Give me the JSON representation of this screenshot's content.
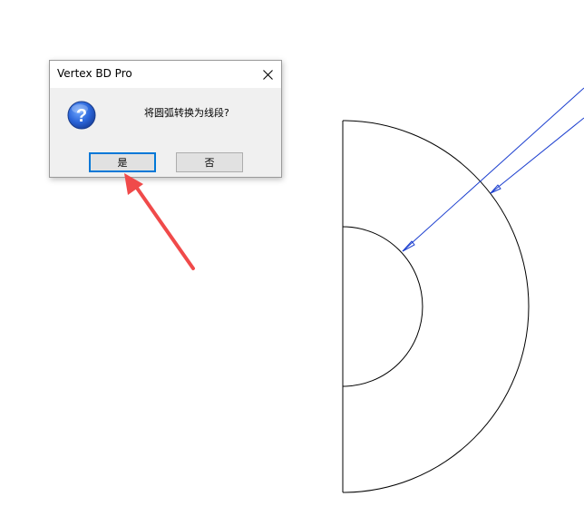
{
  "dialog": {
    "title": "Vertex BD Pro",
    "message": "将圆弧转换为线段?",
    "yes_label": "是",
    "no_label": "否",
    "icon": "question-icon",
    "close_icon": "close-icon"
  },
  "colors": {
    "annotation_arrow": "#f04a4a",
    "dimension_line": "#1c3fcf",
    "drawing_line": "#000000",
    "default_button_border": "#0078d7"
  }
}
